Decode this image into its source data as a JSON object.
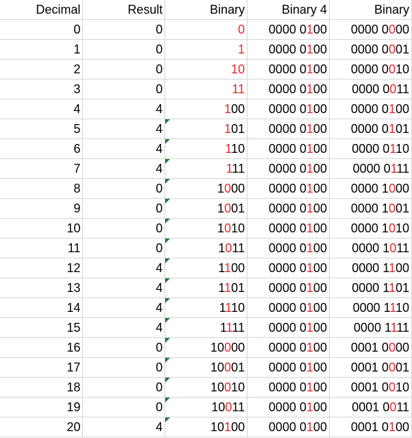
{
  "sheet": {
    "highlight_color": "#e8262a",
    "note_marker_color": "#1e7c34",
    "headers": [
      "Decimal",
      "Result",
      "Binary",
      "Binary 4",
      "Binary"
    ],
    "rows": [
      {
        "decimal": "0",
        "result": "0",
        "result_note": false,
        "binary": [
          [
            "",
            "0"
          ]
        ],
        "binary4": [
          [
            "0000 0",
            "1",
            "00"
          ]
        ],
        "binary8": [
          [
            "0000 0",
            "0",
            "00"
          ]
        ]
      },
      {
        "decimal": "1",
        "result": "0",
        "result_note": false,
        "binary": [
          [
            "",
            "1"
          ]
        ],
        "binary4": [
          [
            "0000 0",
            "1",
            "00"
          ]
        ],
        "binary8": [
          [
            "0000 0",
            "0",
            "01"
          ]
        ]
      },
      {
        "decimal": "2",
        "result": "0",
        "result_note": false,
        "binary": [
          [
            "",
            "10"
          ]
        ],
        "binary4": [
          [
            "0000 0",
            "1",
            "00"
          ]
        ],
        "binary8": [
          [
            "0000 0",
            "0",
            "10"
          ]
        ]
      },
      {
        "decimal": "3",
        "result": "0",
        "result_note": false,
        "binary": [
          [
            "",
            "11"
          ]
        ],
        "binary4": [
          [
            "0000 0",
            "1",
            "00"
          ]
        ],
        "binary8": [
          [
            "0000 0",
            "0",
            "11"
          ]
        ]
      },
      {
        "decimal": "4",
        "result": "4",
        "result_note": false,
        "binary": [
          [
            "",
            "1",
            "00"
          ]
        ],
        "binary4": [
          [
            "0000 0",
            "1",
            "00"
          ]
        ],
        "binary8": [
          [
            "0000 0",
            "1",
            "00"
          ]
        ]
      },
      {
        "decimal": "5",
        "result": "4",
        "result_note": true,
        "binary": [
          [
            "",
            "1",
            "01"
          ]
        ],
        "binary4": [
          [
            "0000 0",
            "1",
            "00"
          ]
        ],
        "binary8": [
          [
            "0000 0",
            "1",
            "01"
          ]
        ]
      },
      {
        "decimal": "6",
        "result": "4",
        "result_note": true,
        "binary": [
          [
            "",
            "1",
            "10"
          ]
        ],
        "binary4": [
          [
            "0000 0",
            "1",
            "00"
          ]
        ],
        "binary8": [
          [
            "0000 0",
            "1",
            "10"
          ]
        ]
      },
      {
        "decimal": "7",
        "result": "4",
        "result_note": true,
        "binary": [
          [
            "",
            "1",
            "11"
          ]
        ],
        "binary4": [
          [
            "0000 0",
            "1",
            "00"
          ]
        ],
        "binary8": [
          [
            "0000 0",
            "1",
            "11"
          ]
        ]
      },
      {
        "decimal": "8",
        "result": "0",
        "result_note": true,
        "binary": [
          [
            "1",
            "0",
            "00"
          ]
        ],
        "binary4": [
          [
            "0000 0",
            "1",
            "00"
          ]
        ],
        "binary8": [
          [
            "0000 1",
            "0",
            "00"
          ]
        ]
      },
      {
        "decimal": "9",
        "result": "0",
        "result_note": true,
        "binary": [
          [
            "1",
            "0",
            "01"
          ]
        ],
        "binary4": [
          [
            "0000 0",
            "1",
            "00"
          ]
        ],
        "binary8": [
          [
            "0000 1",
            "0",
            "01"
          ]
        ]
      },
      {
        "decimal": "10",
        "result": "0",
        "result_note": true,
        "binary": [
          [
            "1",
            "0",
            "10"
          ]
        ],
        "binary4": [
          [
            "0000 0",
            "1",
            "00"
          ]
        ],
        "binary8": [
          [
            "0000 1",
            "0",
            "10"
          ]
        ]
      },
      {
        "decimal": "11",
        "result": "0",
        "result_note": true,
        "binary": [
          [
            "1",
            "0",
            "11"
          ]
        ],
        "binary4": [
          [
            "0000 0",
            "1",
            "00"
          ]
        ],
        "binary8": [
          [
            "0000 1",
            "0",
            "11"
          ]
        ]
      },
      {
        "decimal": "12",
        "result": "4",
        "result_note": true,
        "binary": [
          [
            "1",
            "1",
            "00"
          ]
        ],
        "binary4": [
          [
            "0000 0",
            "1",
            "00"
          ]
        ],
        "binary8": [
          [
            "0000 1",
            "1",
            "00"
          ]
        ]
      },
      {
        "decimal": "13",
        "result": "4",
        "result_note": true,
        "binary": [
          [
            "1",
            "1",
            "01"
          ]
        ],
        "binary4": [
          [
            "0000 0",
            "1",
            "00"
          ]
        ],
        "binary8": [
          [
            "0000 1",
            "1",
            "01"
          ]
        ]
      },
      {
        "decimal": "14",
        "result": "4",
        "result_note": true,
        "binary": [
          [
            "1",
            "1",
            "10"
          ]
        ],
        "binary4": [
          [
            "0000 0",
            "1",
            "00"
          ]
        ],
        "binary8": [
          [
            "0000 1",
            "1",
            "10"
          ]
        ]
      },
      {
        "decimal": "15",
        "result": "4",
        "result_note": true,
        "binary": [
          [
            "1",
            "1",
            "11"
          ]
        ],
        "binary4": [
          [
            "0000 0",
            "1",
            "00"
          ]
        ],
        "binary8": [
          [
            "0000 1",
            "1",
            "11"
          ]
        ]
      },
      {
        "decimal": "16",
        "result": "0",
        "result_note": true,
        "binary": [
          [
            "10",
            "0",
            "00"
          ]
        ],
        "binary4": [
          [
            "0000 0",
            "1",
            "00"
          ]
        ],
        "binary8": [
          [
            "0001 0",
            "0",
            "00"
          ]
        ]
      },
      {
        "decimal": "17",
        "result": "0",
        "result_note": true,
        "binary": [
          [
            "10",
            "0",
            "01"
          ]
        ],
        "binary4": [
          [
            "0000 0",
            "1",
            "00"
          ]
        ],
        "binary8": [
          [
            "0001 0",
            "0",
            "01"
          ]
        ]
      },
      {
        "decimal": "18",
        "result": "0",
        "result_note": true,
        "binary": [
          [
            "10",
            "0",
            "10"
          ]
        ],
        "binary4": [
          [
            "0000 0",
            "1",
            "00"
          ]
        ],
        "binary8": [
          [
            "0001 0",
            "0",
            "10"
          ]
        ]
      },
      {
        "decimal": "19",
        "result": "0",
        "result_note": true,
        "binary": [
          [
            "10",
            "0",
            "11"
          ]
        ],
        "binary4": [
          [
            "0000 0",
            "1",
            "00"
          ]
        ],
        "binary8": [
          [
            "0001 0",
            "0",
            "11"
          ]
        ]
      },
      {
        "decimal": "20",
        "result": "4",
        "result_note": true,
        "binary": [
          [
            "10",
            "1",
            "00"
          ]
        ],
        "binary4": [
          [
            "0000 0",
            "1",
            "00"
          ]
        ],
        "binary8": [
          [
            "0001 0",
            "1",
            "00"
          ]
        ]
      }
    ]
  }
}
